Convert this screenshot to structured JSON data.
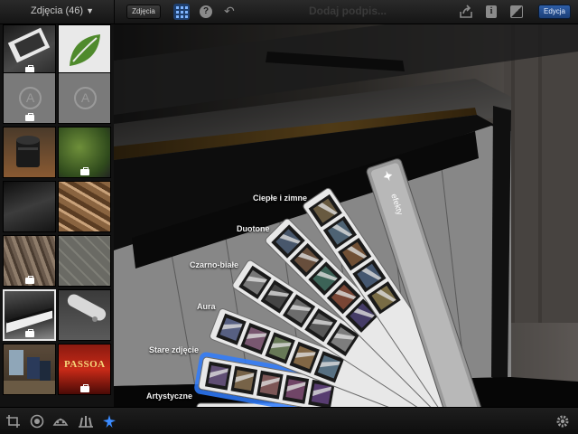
{
  "topbar": {
    "album_title": "Zdjęcia (46)",
    "photos_button": "Zdjęcia",
    "caption_placeholder": "Dodaj podpis...",
    "edit_button": "Edycja"
  },
  "effects_fan": {
    "header": "efekty",
    "categories": [
      {
        "label": "Ciepłe i zimne"
      },
      {
        "label": "Duotone"
      },
      {
        "label": "Czarno-białe"
      },
      {
        "label": "Aura"
      },
      {
        "label": "Stare zdjęcie",
        "selected": true
      },
      {
        "label": "Artystyczne"
      }
    ]
  },
  "thumbnails": [
    {
      "subject": "dark-glass",
      "badge": true
    },
    {
      "subject": "green-leaf",
      "badge": false
    },
    {
      "subject": "app-placeholder",
      "badge": true
    },
    {
      "subject": "app-placeholder",
      "badge": false
    },
    {
      "subject": "camera-lens",
      "badge": false
    },
    {
      "subject": "green-plant",
      "badge": true
    },
    {
      "subject": "dark-car",
      "badge": false
    },
    {
      "subject": "wood-logs",
      "badge": false
    },
    {
      "subject": "bark",
      "badge": true
    },
    {
      "subject": "paving-stones",
      "badge": false
    },
    {
      "subject": "piano",
      "badge": true,
      "selected": true
    },
    {
      "subject": "remote",
      "badge": false
    },
    {
      "subject": "room",
      "badge": false
    },
    {
      "subject": "passoa-bottle",
      "badge": true,
      "text": "PASSOA"
    }
  ],
  "colors": {
    "accent": "#3b8bff",
    "edit_button": "#2a5aa4",
    "selected_glow": "#2f7dff"
  },
  "bottom_tools": [
    "crop-icon",
    "color-icon",
    "brush-icon",
    "adjust-icon",
    "effects-icon",
    "settings-icon"
  ]
}
